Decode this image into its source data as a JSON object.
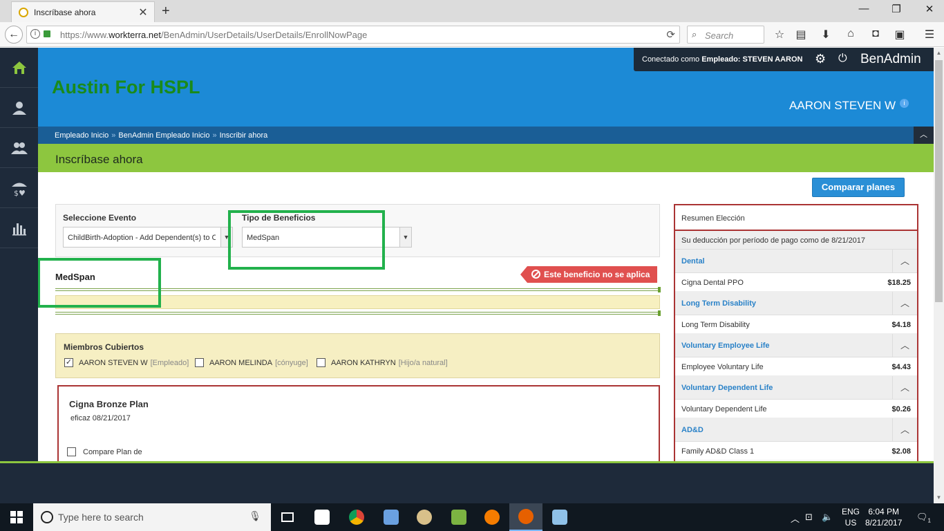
{
  "browser": {
    "tab_title": "Inscríbase ahora",
    "url_prefix": "https://www.",
    "url_domain": "workterra.net",
    "url_path": "/BenAdmin/UserDetails/UserDetails/EnrollNowPage",
    "search_placeholder": "Search"
  },
  "header": {
    "company": "Austin For HSPL",
    "connected_prefix": "Conectado como ",
    "connected_role": "Empleado:",
    "connected_user": "STEVEN AARON",
    "brand": "BenAdmin",
    "user_display": "AARON STEVEN W"
  },
  "breadcrumb": {
    "items": [
      "Empleado Inicio",
      "BenAdmin Empleado Inicio",
      "Inscribir ahora"
    ],
    "separator": "»"
  },
  "page_title": "Inscríbase ahora",
  "compare_button": "Comparar planes",
  "filters": {
    "event_label": "Seleccione Evento",
    "event_value": "ChildBirth-Adoption - Add Dependent(s) to C",
    "benefit_label": "Tipo de Beneficios",
    "benefit_value": "MedSpan"
  },
  "section": {
    "title": "MedSpan",
    "not_applicable": "Este beneficio no se aplica"
  },
  "members": {
    "label": "Miembros Cubiertos",
    "items": [
      {
        "name": "AARON STEVEN W",
        "relation": "[Empleado]",
        "checked": "✓"
      },
      {
        "name": "AARON MELINDA",
        "relation": "[cónyuge]",
        "checked": ""
      },
      {
        "name": "AARON KATHRYN",
        "relation": "[Hijo/a natural]",
        "checked": ""
      }
    ]
  },
  "plan": {
    "name": "Cigna Bronze Plan",
    "effective": "eficaz 08/21/2017",
    "compare": "Compare Plan de"
  },
  "summary": {
    "title": "Resumen Elección",
    "deduction": "Su deducción por período de pago como de 8/21/2017",
    "groups": [
      {
        "name": "Dental",
        "item": "Cigna Dental PPO",
        "amount": "$18.25"
      },
      {
        "name": "Long Term Disability",
        "item": "Long Term Disability",
        "amount": "$4.18"
      },
      {
        "name": "Voluntary Employee Life",
        "item": "Employee Voluntary Life",
        "amount": "$4.43"
      },
      {
        "name": "Voluntary Dependent Life",
        "item": "Voluntary Dependent Life",
        "amount": "$0.26"
      },
      {
        "name": "AD&D",
        "item": "Family AD&D Class 1",
        "amount": "$2.08"
      }
    ]
  },
  "taskbar": {
    "search_placeholder": "Type here to search",
    "lang_top": "ENG",
    "lang_bottom": "US",
    "time": "6:04 PM",
    "date": "8/21/2017",
    "notif_count": "1"
  },
  "colors": {
    "header_blue": "#1c8ad6",
    "title_green": "#8dc63f",
    "company_green": "#1a8a1a",
    "highlight_green": "#22b14c",
    "alert_red": "#e0504f"
  }
}
